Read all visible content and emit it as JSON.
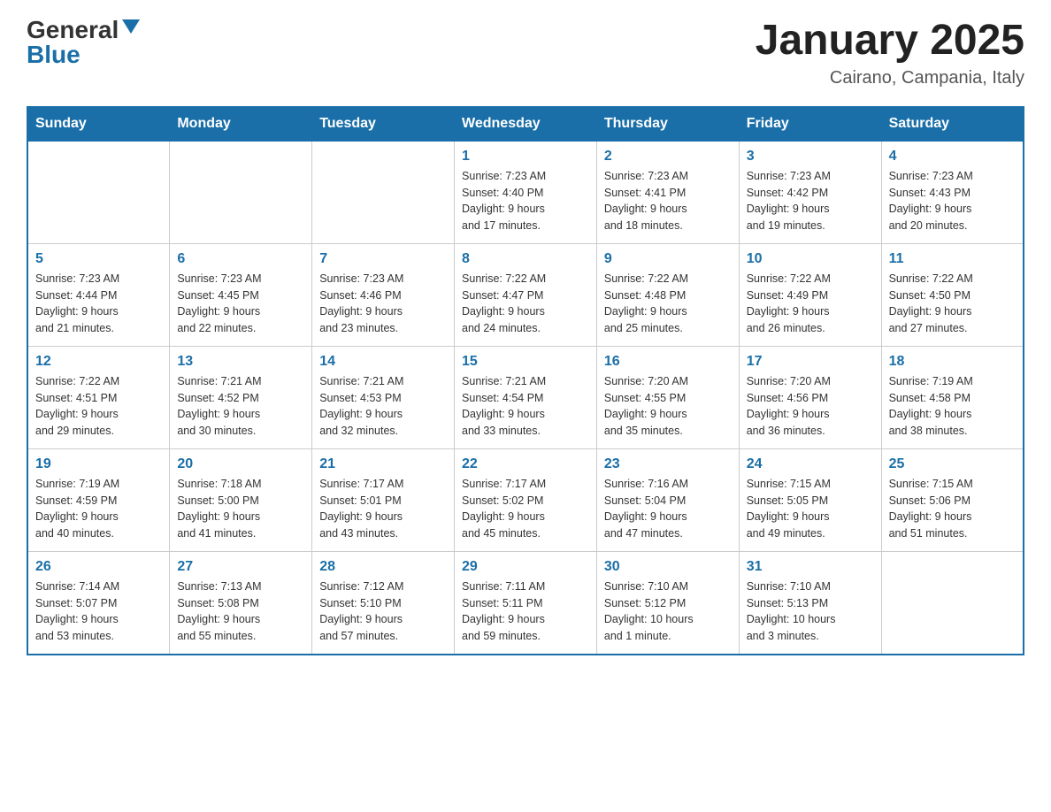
{
  "header": {
    "logo_general": "General",
    "logo_blue": "Blue",
    "month_title": "January 2025",
    "location": "Cairano, Campania, Italy"
  },
  "weekdays": [
    "Sunday",
    "Monday",
    "Tuesday",
    "Wednesday",
    "Thursday",
    "Friday",
    "Saturday"
  ],
  "weeks": [
    [
      {
        "day": "",
        "info": ""
      },
      {
        "day": "",
        "info": ""
      },
      {
        "day": "",
        "info": ""
      },
      {
        "day": "1",
        "info": "Sunrise: 7:23 AM\nSunset: 4:40 PM\nDaylight: 9 hours\nand 17 minutes."
      },
      {
        "day": "2",
        "info": "Sunrise: 7:23 AM\nSunset: 4:41 PM\nDaylight: 9 hours\nand 18 minutes."
      },
      {
        "day": "3",
        "info": "Sunrise: 7:23 AM\nSunset: 4:42 PM\nDaylight: 9 hours\nand 19 minutes."
      },
      {
        "day": "4",
        "info": "Sunrise: 7:23 AM\nSunset: 4:43 PM\nDaylight: 9 hours\nand 20 minutes."
      }
    ],
    [
      {
        "day": "5",
        "info": "Sunrise: 7:23 AM\nSunset: 4:44 PM\nDaylight: 9 hours\nand 21 minutes."
      },
      {
        "day": "6",
        "info": "Sunrise: 7:23 AM\nSunset: 4:45 PM\nDaylight: 9 hours\nand 22 minutes."
      },
      {
        "day": "7",
        "info": "Sunrise: 7:23 AM\nSunset: 4:46 PM\nDaylight: 9 hours\nand 23 minutes."
      },
      {
        "day": "8",
        "info": "Sunrise: 7:22 AM\nSunset: 4:47 PM\nDaylight: 9 hours\nand 24 minutes."
      },
      {
        "day": "9",
        "info": "Sunrise: 7:22 AM\nSunset: 4:48 PM\nDaylight: 9 hours\nand 25 minutes."
      },
      {
        "day": "10",
        "info": "Sunrise: 7:22 AM\nSunset: 4:49 PM\nDaylight: 9 hours\nand 26 minutes."
      },
      {
        "day": "11",
        "info": "Sunrise: 7:22 AM\nSunset: 4:50 PM\nDaylight: 9 hours\nand 27 minutes."
      }
    ],
    [
      {
        "day": "12",
        "info": "Sunrise: 7:22 AM\nSunset: 4:51 PM\nDaylight: 9 hours\nand 29 minutes."
      },
      {
        "day": "13",
        "info": "Sunrise: 7:21 AM\nSunset: 4:52 PM\nDaylight: 9 hours\nand 30 minutes."
      },
      {
        "day": "14",
        "info": "Sunrise: 7:21 AM\nSunset: 4:53 PM\nDaylight: 9 hours\nand 32 minutes."
      },
      {
        "day": "15",
        "info": "Sunrise: 7:21 AM\nSunset: 4:54 PM\nDaylight: 9 hours\nand 33 minutes."
      },
      {
        "day": "16",
        "info": "Sunrise: 7:20 AM\nSunset: 4:55 PM\nDaylight: 9 hours\nand 35 minutes."
      },
      {
        "day": "17",
        "info": "Sunrise: 7:20 AM\nSunset: 4:56 PM\nDaylight: 9 hours\nand 36 minutes."
      },
      {
        "day": "18",
        "info": "Sunrise: 7:19 AM\nSunset: 4:58 PM\nDaylight: 9 hours\nand 38 minutes."
      }
    ],
    [
      {
        "day": "19",
        "info": "Sunrise: 7:19 AM\nSunset: 4:59 PM\nDaylight: 9 hours\nand 40 minutes."
      },
      {
        "day": "20",
        "info": "Sunrise: 7:18 AM\nSunset: 5:00 PM\nDaylight: 9 hours\nand 41 minutes."
      },
      {
        "day": "21",
        "info": "Sunrise: 7:17 AM\nSunset: 5:01 PM\nDaylight: 9 hours\nand 43 minutes."
      },
      {
        "day": "22",
        "info": "Sunrise: 7:17 AM\nSunset: 5:02 PM\nDaylight: 9 hours\nand 45 minutes."
      },
      {
        "day": "23",
        "info": "Sunrise: 7:16 AM\nSunset: 5:04 PM\nDaylight: 9 hours\nand 47 minutes."
      },
      {
        "day": "24",
        "info": "Sunrise: 7:15 AM\nSunset: 5:05 PM\nDaylight: 9 hours\nand 49 minutes."
      },
      {
        "day": "25",
        "info": "Sunrise: 7:15 AM\nSunset: 5:06 PM\nDaylight: 9 hours\nand 51 minutes."
      }
    ],
    [
      {
        "day": "26",
        "info": "Sunrise: 7:14 AM\nSunset: 5:07 PM\nDaylight: 9 hours\nand 53 minutes."
      },
      {
        "day": "27",
        "info": "Sunrise: 7:13 AM\nSunset: 5:08 PM\nDaylight: 9 hours\nand 55 minutes."
      },
      {
        "day": "28",
        "info": "Sunrise: 7:12 AM\nSunset: 5:10 PM\nDaylight: 9 hours\nand 57 minutes."
      },
      {
        "day": "29",
        "info": "Sunrise: 7:11 AM\nSunset: 5:11 PM\nDaylight: 9 hours\nand 59 minutes."
      },
      {
        "day": "30",
        "info": "Sunrise: 7:10 AM\nSunset: 5:12 PM\nDaylight: 10 hours\nand 1 minute."
      },
      {
        "day": "31",
        "info": "Sunrise: 7:10 AM\nSunset: 5:13 PM\nDaylight: 10 hours\nand 3 minutes."
      },
      {
        "day": "",
        "info": ""
      }
    ]
  ]
}
